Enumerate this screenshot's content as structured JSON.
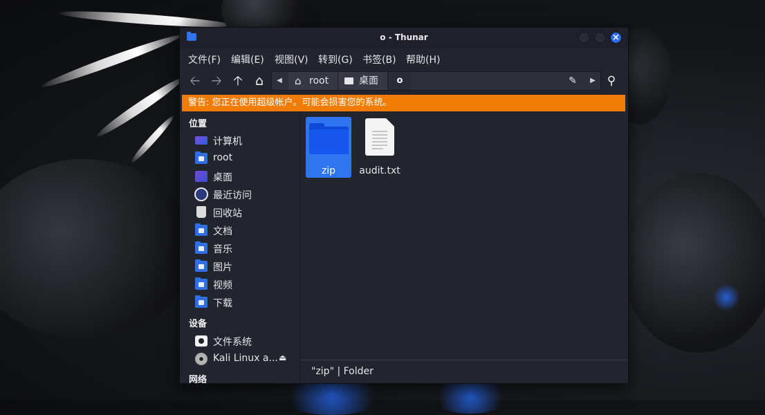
{
  "window": {
    "title": "o - Thunar",
    "close_glyph": "×"
  },
  "menu": [
    "文件(F)",
    "编辑(E)",
    "视图(V)",
    "转到(G)",
    "书签(B)",
    "帮助(H)"
  ],
  "toolbar": {
    "back_icon": "arrow-left-icon",
    "forward_icon": "arrow-right-icon",
    "up_icon": "arrow-up-icon",
    "home_icon": "home-icon",
    "search_icon": "search-icon"
  },
  "pathbar": {
    "segments": [
      "root",
      "桌面"
    ],
    "current": "o"
  },
  "warning": {
    "text": "警告: 您正在使用超级帐户。可能会损害您的系统。",
    "color": "#f07c06"
  },
  "sidebar": {
    "sections": [
      {
        "heading": "位置",
        "items": [
          {
            "label": "计算机",
            "icon": "computer-icon"
          },
          {
            "label": "root",
            "icon": "home-folder-icon"
          },
          {
            "label": "桌面",
            "icon": "desktop-icon"
          },
          {
            "label": "最近访问",
            "icon": "recent-icon"
          },
          {
            "label": "回收站",
            "icon": "trash-icon"
          },
          {
            "label": "文档",
            "icon": "documents-folder-icon"
          },
          {
            "label": "音乐",
            "icon": "music-folder-icon"
          },
          {
            "label": "图片",
            "icon": "pictures-folder-icon"
          },
          {
            "label": "视频",
            "icon": "videos-folder-icon"
          },
          {
            "label": "下载",
            "icon": "downloads-folder-icon"
          }
        ]
      },
      {
        "heading": "设备",
        "items": [
          {
            "label": "文件系统",
            "icon": "drive-icon"
          },
          {
            "label": "Kali Linux a...",
            "icon": "optical-disc-icon",
            "eject": "eject-icon"
          }
        ]
      },
      {
        "heading": "网络",
        "items": []
      }
    ]
  },
  "files": [
    {
      "name": "zip",
      "type": "folder",
      "selected": true
    },
    {
      "name": "audit.txt",
      "type": "text",
      "selected": false
    }
  ],
  "status": {
    "text": "\"zip\" | Folder"
  },
  "colors": {
    "accent": "#2f74f0",
    "window_bg": "#23252e",
    "folder": "#1656ee"
  }
}
